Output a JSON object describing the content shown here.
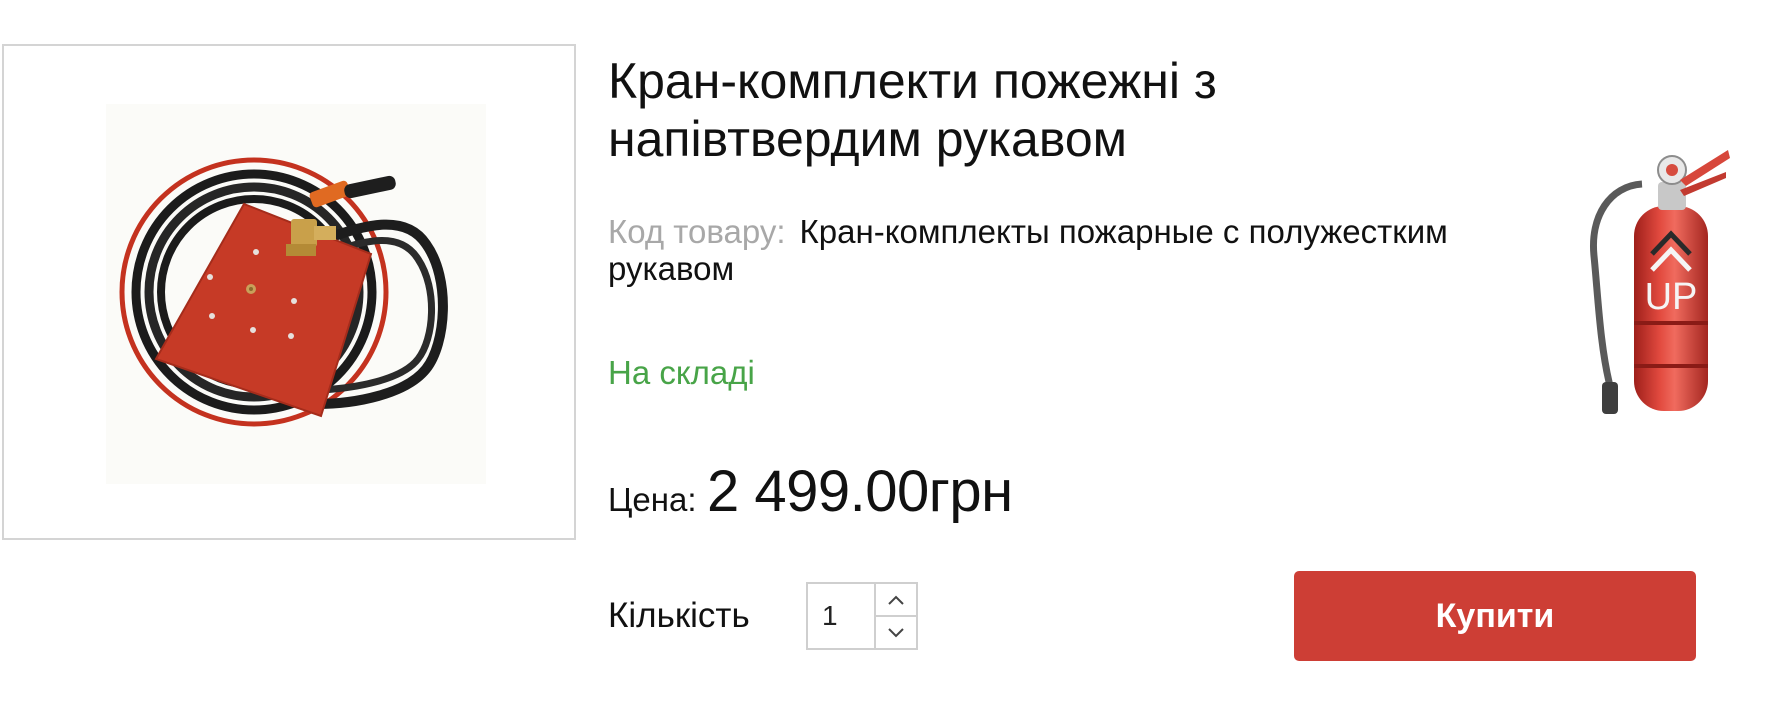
{
  "product": {
    "title": "Кран-комплекти пожежні з напівтвердим рукавом",
    "image_icon": "fire-hose-reel-image"
  },
  "sku": {
    "label": "Код товару:",
    "value": "Кран-комплекты пожарные с полужестким рукавом"
  },
  "stock": {
    "status": "На складі",
    "color": "#48a448"
  },
  "price": {
    "label": "Цена:",
    "value": "2 499.00грн"
  },
  "quantity": {
    "label": "Кількість",
    "value": "1",
    "increment_icon": "chevron-up-icon",
    "decrement_icon": "chevron-down-icon"
  },
  "actions": {
    "buy_label": "Купити",
    "buy_color": "#cd3e35"
  },
  "badge": {
    "icon": "fire-extinguisher-icon",
    "text": "UP"
  }
}
